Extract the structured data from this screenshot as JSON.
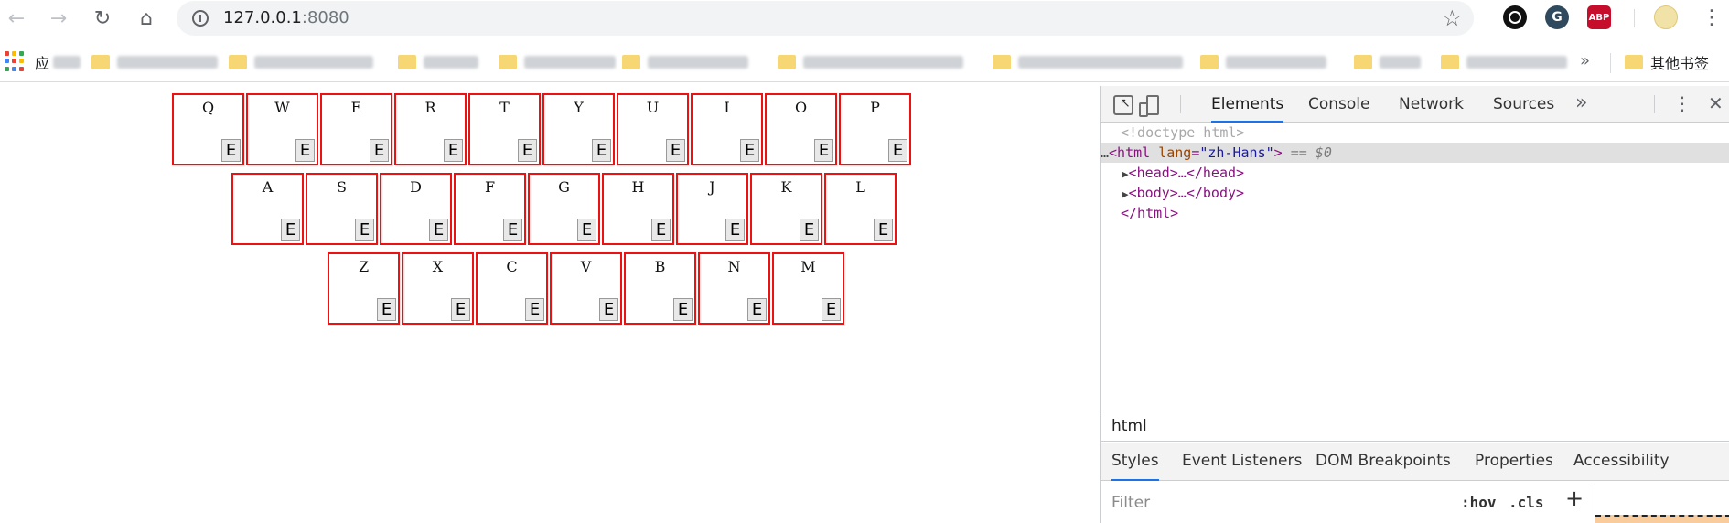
{
  "browser": {
    "url_host": "127.0.0.1",
    "url_port": ":8080",
    "ext_shield_glyph": "G",
    "ext_abp_label": "ABP",
    "more_glyph": "⋮"
  },
  "bookmarks": {
    "apps_label": "应",
    "more_glyph": "»",
    "other_label": "其他书签"
  },
  "keyboard": {
    "rows": [
      [
        "Q",
        "W",
        "E",
        "R",
        "T",
        "Y",
        "U",
        "I",
        "O",
        "P"
      ],
      [
        "A",
        "S",
        "D",
        "F",
        "G",
        "H",
        "J",
        "K",
        "L"
      ],
      [
        "Z",
        "X",
        "C",
        "V",
        "B",
        "N",
        "M"
      ]
    ],
    "key_button_label": "E",
    "border_color": "#ee1111"
  },
  "devtools": {
    "tabs": [
      "Elements",
      "Console",
      "Network",
      "Sources"
    ],
    "active_tab": "Elements",
    "overflow_glyph": "»",
    "dom": {
      "doctype": "<!doctype html>",
      "html_open_tag": "<html",
      "lang_attr": "lang",
      "lang_value": "\"zh-Hans\"",
      "html_open_close": ">",
      "selected_marker": "== $0",
      "head": "<head>…</head>",
      "body": "<body>…</body>",
      "html_close": "</html>"
    },
    "breadcrumb": "html",
    "sub_tabs": [
      "Styles",
      "Event Listeners",
      "DOM Breakpoints",
      "Properties",
      "Accessibility"
    ],
    "active_sub_tab": "Styles",
    "filter_placeholder": "Filter",
    "hov_label": ":hov",
    "cls_label": ".cls"
  }
}
